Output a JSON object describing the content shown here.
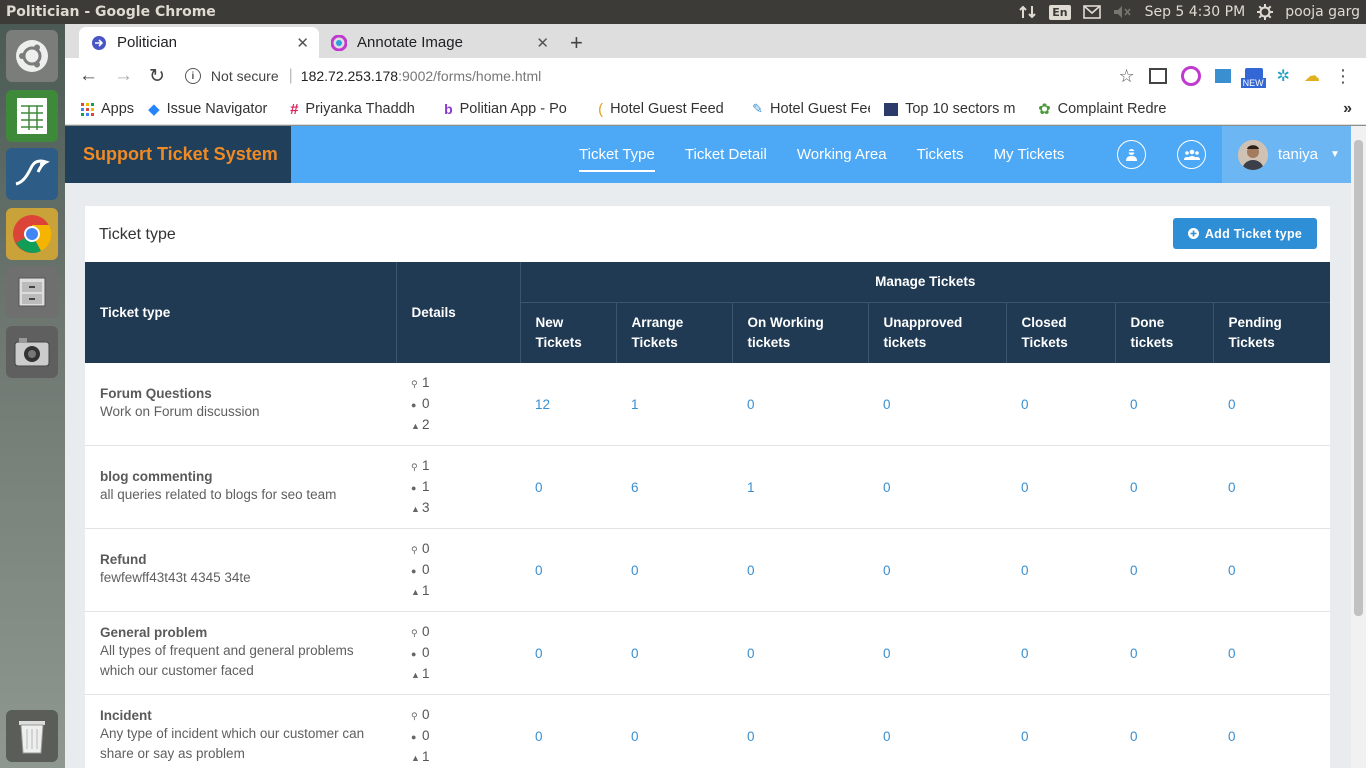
{
  "os": {
    "window_title": "Politician - Google Chrome",
    "lang": "En",
    "datetime": "Sep  5  4:30 PM",
    "user": "pooja garg"
  },
  "tabs": [
    {
      "label": "Politician",
      "active": true
    },
    {
      "label": "Annotate Image",
      "active": false
    }
  ],
  "toolbar": {
    "security": "Not secure",
    "url_host": "182.72.253.178",
    "url_rest": ":9002/forms/home.html",
    "ext_badge": "NEW"
  },
  "bookmarks": [
    {
      "label": "Apps",
      "icon": "apps-grid-icon"
    },
    {
      "label": "Issue Navigator",
      "icon": "jira-icon"
    },
    {
      "label": "Priyanka Thaddh",
      "icon": "slack-icon"
    },
    {
      "label": "Politian App - Po",
      "icon": "app-b-icon"
    },
    {
      "label": "Hotel Guest Feed",
      "icon": "feed-icon"
    },
    {
      "label": "Hotel Guest Feed",
      "icon": "feed2-icon"
    },
    {
      "label": "Top 10 sectors m",
      "icon": "doc-icon"
    },
    {
      "label": "Complaint Redre",
      "icon": "gear-color-icon"
    }
  ],
  "app": {
    "brand": "Support Ticket System",
    "nav": [
      {
        "label": "Ticket Type",
        "active": true
      },
      {
        "label": "Ticket Detail",
        "active": false
      },
      {
        "label": "Working Area",
        "active": false
      },
      {
        "label": "Tickets",
        "active": false
      },
      {
        "label": "My Tickets",
        "active": false
      }
    ],
    "user": "taniya",
    "accent": "#4da8f5",
    "brand_bg": "#1f3f5a",
    "brand_color": "#f08a24"
  },
  "card": {
    "title": "Ticket type",
    "add_button": "Add Ticket type"
  },
  "table": {
    "col_ticket_type": "Ticket type",
    "col_details": "Details",
    "col_group": "Manage Tickets",
    "sub_cols": [
      [
        "New",
        "Tickets"
      ],
      [
        "Arrange",
        "Tickets"
      ],
      [
        "On Working",
        "tickets"
      ],
      [
        "Unapproved",
        "tickets"
      ],
      [
        "Closed",
        "Tickets"
      ],
      [
        "Done",
        "tickets"
      ],
      [
        "Pending",
        "Tickets"
      ]
    ],
    "rows": [
      {
        "name": "Forum Questions",
        "desc": "Work on Forum discussion",
        "details": [
          "1",
          "0",
          "2"
        ],
        "values": [
          "12",
          "1",
          "0",
          "0",
          "0",
          "0",
          "0"
        ]
      },
      {
        "name": "blog commenting",
        "desc": "all queries related to blogs for seo team",
        "details": [
          "1",
          "1",
          "3"
        ],
        "values": [
          "0",
          "6",
          "1",
          "0",
          "0",
          "0",
          "0"
        ]
      },
      {
        "name": "Refund",
        "desc": "fewfewff43t43t 4345 34te",
        "details": [
          "0",
          "0",
          "1"
        ],
        "values": [
          "0",
          "0",
          "0",
          "0",
          "0",
          "0",
          "0"
        ]
      },
      {
        "name": "General problem",
        "desc": "All types of frequent and general problems which our customer faced",
        "details": [
          "0",
          "0",
          "1"
        ],
        "values": [
          "0",
          "0",
          "0",
          "0",
          "0",
          "0",
          "0"
        ]
      },
      {
        "name": "Incident",
        "desc": "Any type of incident which our customer can share or say as problem",
        "details": [
          "0",
          "0",
          "1"
        ],
        "values": [
          "0",
          "0",
          "0",
          "0",
          "0",
          "0",
          "0"
        ]
      }
    ]
  }
}
